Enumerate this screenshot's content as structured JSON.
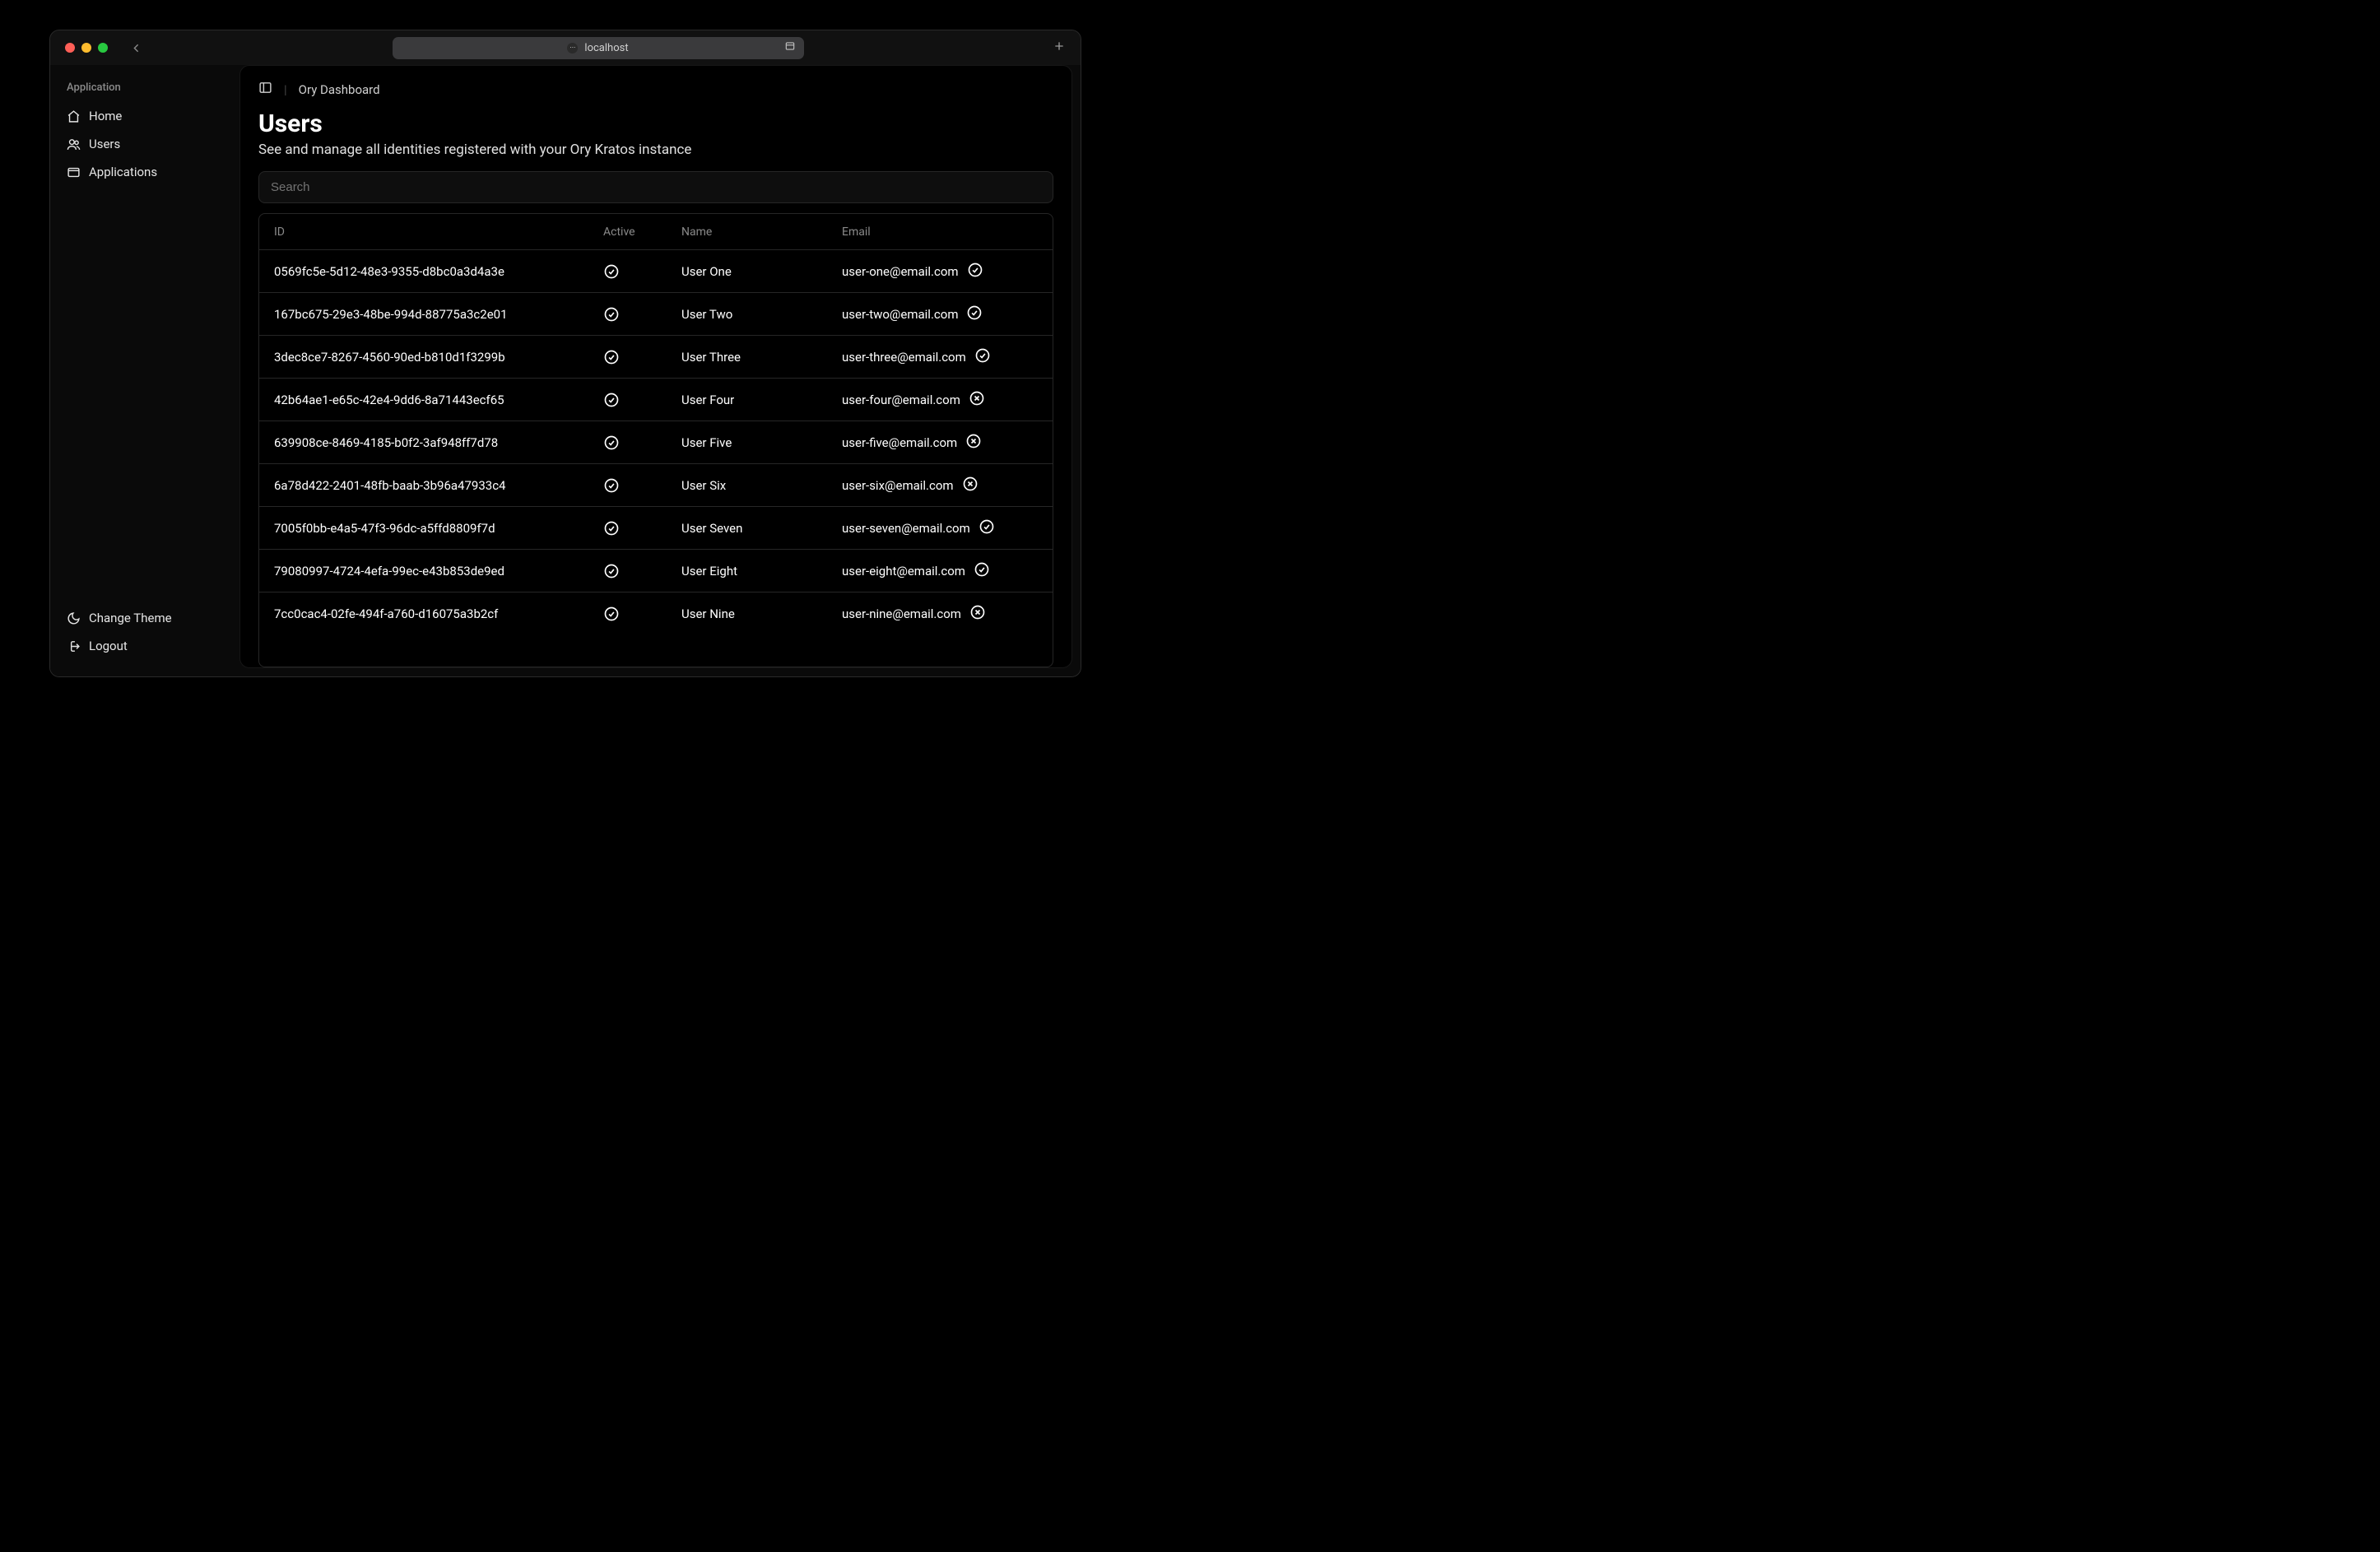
{
  "browser": {
    "url_text": "localhost"
  },
  "sidebar": {
    "section_label": "Application",
    "items": [
      {
        "label": "Home"
      },
      {
        "label": "Users"
      },
      {
        "label": "Applications"
      }
    ],
    "footer": {
      "theme_label": "Change Theme",
      "logout_label": "Logout"
    }
  },
  "breadcrumb": {
    "title": "Ory Dashboard"
  },
  "page": {
    "title": "Users",
    "subtitle": "See and manage all identities registered with your Ory Kratos instance",
    "search_placeholder": "Search"
  },
  "table": {
    "columns": {
      "id": "ID",
      "active": "Active",
      "name": "Name",
      "email": "Email"
    },
    "rows": [
      {
        "id": "0569fc5e-5d12-48e3-9355-d8bc0a3d4a3e",
        "active": true,
        "name": "User One",
        "email": "user-one@email.com",
        "email_verified": true
      },
      {
        "id": "167bc675-29e3-48be-994d-88775a3c2e01",
        "active": true,
        "name": "User Two",
        "email": "user-two@email.com",
        "email_verified": true
      },
      {
        "id": "3dec8ce7-8267-4560-90ed-b810d1f3299b",
        "active": true,
        "name": "User Three",
        "email": "user-three@email.com",
        "email_verified": true
      },
      {
        "id": "42b64ae1-e65c-42e4-9dd6-8a71443ecf65",
        "active": true,
        "name": "User Four",
        "email": "user-four@email.com",
        "email_verified": false
      },
      {
        "id": "639908ce-8469-4185-b0f2-3af948ff7d78",
        "active": true,
        "name": "User Five",
        "email": "user-five@email.com",
        "email_verified": false
      },
      {
        "id": "6a78d422-2401-48fb-baab-3b96a47933c4",
        "active": true,
        "name": "User Six",
        "email": "user-six@email.com",
        "email_verified": false
      },
      {
        "id": "7005f0bb-e4a5-47f3-96dc-a5ffd8809f7d",
        "active": true,
        "name": "User Seven",
        "email": "user-seven@email.com",
        "email_verified": true
      },
      {
        "id": "79080997-4724-4efa-99ec-e43b853de9ed",
        "active": true,
        "name": "User Eight",
        "email": "user-eight@email.com",
        "email_verified": true
      },
      {
        "id": "7cc0cac4-02fe-494f-a760-d16075a3b2cf",
        "active": true,
        "name": "User Nine",
        "email": "user-nine@email.com",
        "email_verified": false
      }
    ]
  }
}
